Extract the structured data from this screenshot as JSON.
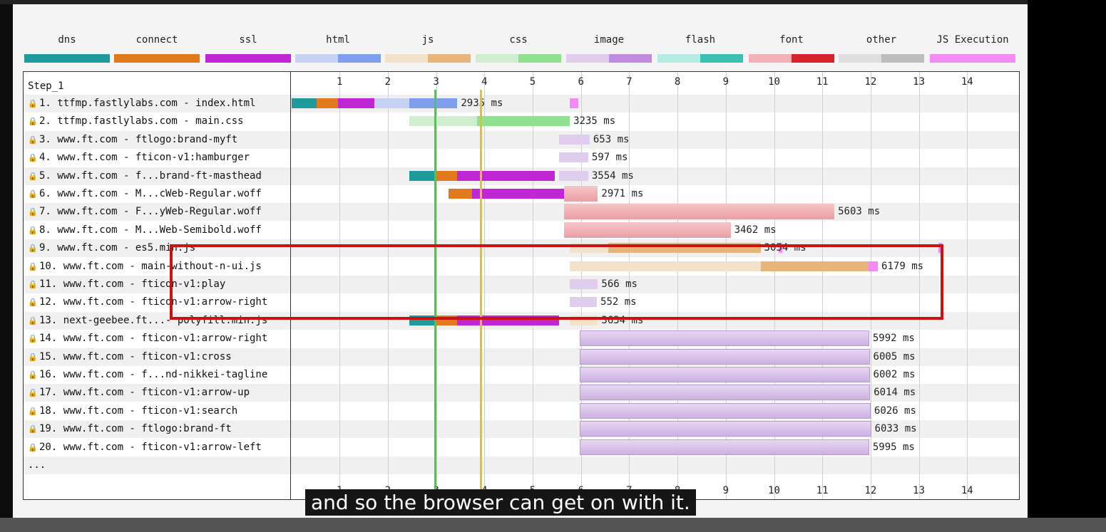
{
  "legend": [
    {
      "label": "dns",
      "colors": [
        "#1e9a9a"
      ]
    },
    {
      "label": "connect",
      "colors": [
        "#e07a1c"
      ]
    },
    {
      "label": "ssl",
      "colors": [
        "#c026d3"
      ]
    },
    {
      "label": "html",
      "colors": [
        "#c7d2f2",
        "#7f9ef0"
      ]
    },
    {
      "label": "js",
      "colors": [
        "#f1e2c9",
        "#e6b57a"
      ]
    },
    {
      "label": "css",
      "colors": [
        "#cfeecf",
        "#8fe08f"
      ]
    },
    {
      "label": "image",
      "colors": [
        "#e0cdee",
        "#c08adf"
      ]
    },
    {
      "label": "flash",
      "colors": [
        "#b4ece4",
        "#3bbfb1"
      ]
    },
    {
      "label": "font",
      "colors": [
        "#f3b3b6",
        "#d7222c"
      ]
    },
    {
      "label": "other",
      "colors": [
        "#dedede",
        "#bdbdbd"
      ]
    },
    {
      "label": "JS Execution",
      "colors": [
        "#f08cf2"
      ]
    }
  ],
  "step_label": "Step_1",
  "axis": {
    "ticks": [
      "1",
      "2",
      "3",
      "4",
      "5",
      "6",
      "7",
      "8",
      "9",
      "10",
      "11",
      "12",
      "13",
      "14"
    ]
  },
  "rows": [
    {
      "label": "1. ttfmp.fastlylabs.com - index.html",
      "duration": "2935 ms"
    },
    {
      "label": "2. ttfmp.fastlylabs.com - main.css",
      "duration": "3235 ms"
    },
    {
      "label": "3. www.ft.com - ftlogo:brand-myft",
      "duration": "653 ms"
    },
    {
      "label": "4. www.ft.com - fticon-v1:hamburger",
      "duration": "597 ms"
    },
    {
      "label": "5. www.ft.com - f...brand-ft-masthead",
      "duration": "3554 ms"
    },
    {
      "label": "6. www.ft.com - M...cWeb-Regular.woff",
      "duration": "2971 ms"
    },
    {
      "label": "7. www.ft.com - F...yWeb-Regular.woff",
      "duration": "5603 ms"
    },
    {
      "label": "8. www.ft.com - M...Web-Semibold.woff",
      "duration": "3462 ms"
    },
    {
      "label": "9. www.ft.com - es5.min.js",
      "duration": "3054 ms"
    },
    {
      "label": "10. www.ft.com - main-without-n-ui.js",
      "duration": "6179 ms"
    },
    {
      "label": "11. www.ft.com - fticon-v1:play",
      "duration": "566 ms"
    },
    {
      "label": "12. www.ft.com - fticon-v1:arrow-right",
      "duration": "552 ms"
    },
    {
      "label": "13. next-geebee.ft...- polyfill.min.js",
      "duration": "3634 ms"
    },
    {
      "label": "14. www.ft.com - fticon-v1:arrow-right",
      "duration": "5992 ms"
    },
    {
      "label": "15. www.ft.com - fticon-v1:cross",
      "duration": "6005 ms"
    },
    {
      "label": "16. www.ft.com - f...nd-nikkei-tagline",
      "duration": "6002 ms"
    },
    {
      "label": "17. www.ft.com - fticon-v1:arrow-up",
      "duration": "6014 ms"
    },
    {
      "label": "18. www.ft.com - fticon-v1:search",
      "duration": "6026 ms"
    },
    {
      "label": "19. www.ft.com - ftlogo:brand-ft",
      "duration": "6033 ms"
    },
    {
      "label": "20. www.ft.com - fticon-v1:arrow-left",
      "duration": "5995 ms"
    }
  ],
  "more_label": "...",
  "markers": [
    {
      "name": "start-render",
      "color": "#3fd23f",
      "at_s": 2.97
    },
    {
      "name": "dom-content-loaded",
      "color": "#e6c21a",
      "at_s": 3.92
    }
  ],
  "caption": "and so the browser can get on with it."
}
